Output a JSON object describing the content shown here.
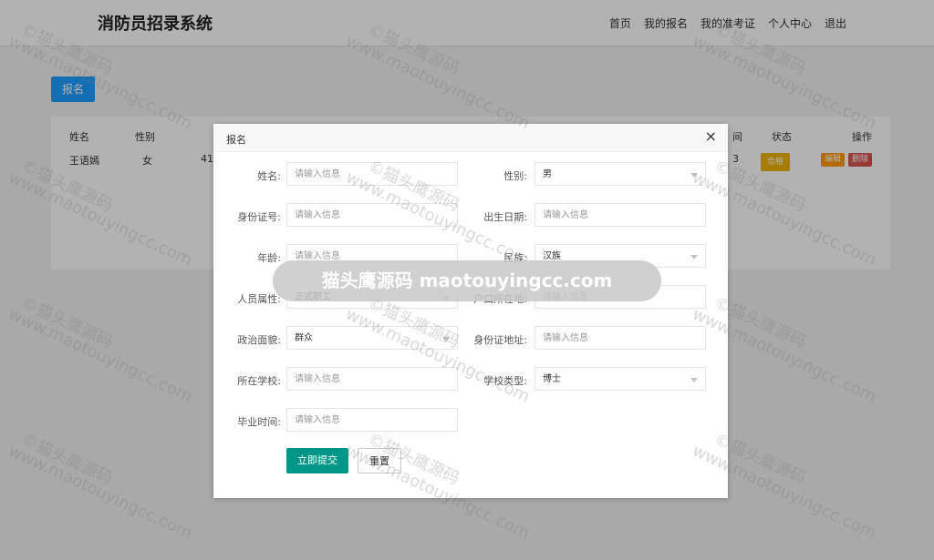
{
  "header": {
    "title": "消防员招录系统",
    "nav": [
      "首页",
      "我的报名",
      "我的准考证",
      "个人中心",
      "退出"
    ]
  },
  "page": {
    "signup_button": "报名",
    "table": {
      "headers": [
        "姓名",
        "性别",
        "状态",
        "操作"
      ],
      "row": {
        "name": "王语嫣",
        "gender": "女",
        "partial_left": "41",
        "partial_right": "3",
        "status": "合格",
        "edit": "编辑",
        "delete": "删除"
      },
      "partial_header_right": "间"
    },
    "status_color": "#f0b400",
    "edit_color": "#ff9800",
    "delete_color": "#d9534f"
  },
  "modal": {
    "title": "报名",
    "close": "×",
    "fields": {
      "name": {
        "label": "姓名:",
        "placeholder": "请输入信息"
      },
      "gender": {
        "label": "性别:",
        "value": "男"
      },
      "id_number": {
        "label": "身份证号:",
        "placeholder": "请输入信息"
      },
      "birth_date": {
        "label": "出生日期:",
        "placeholder": "请输入信息"
      },
      "age": {
        "label": "年龄:",
        "placeholder": "请输入信息"
      },
      "ethnicity": {
        "label": "民族:",
        "value": "汉族"
      },
      "personnel_type": {
        "label": "人员属性:",
        "value": "正式职工"
      },
      "hukou": {
        "label": "户口所在地:",
        "placeholder": "请输入信息"
      },
      "political_status": {
        "label": "政治面貌:",
        "value": "群众"
      },
      "id_address": {
        "label": "身份证地址:",
        "placeholder": "请输入信息"
      },
      "school": {
        "label": "所在学校:",
        "placeholder": "请输入信息"
      },
      "school_type": {
        "label": "学校类型:",
        "value": "博士"
      },
      "graduation_time": {
        "label": "毕业时间:",
        "placeholder": "请输入信息"
      }
    },
    "submit": "立即提交",
    "reset": "重置"
  },
  "watermark": {
    "line1": "©猫头鹰源码",
    "line2": "www.maotouyingcc.com",
    "pill": "猫头鹰源码 maotouyingcc.com"
  },
  "colors": {
    "primary": "#1e9fff",
    "submit": "#009688"
  }
}
